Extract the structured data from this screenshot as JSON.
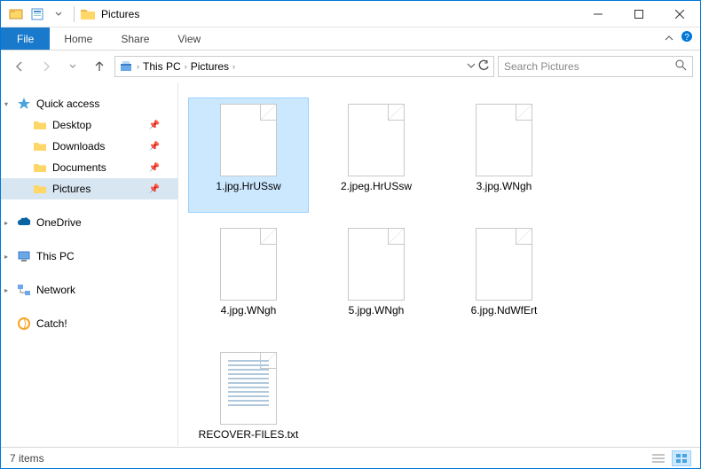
{
  "title": "Pictures",
  "tabs": {
    "file": "File",
    "home": "Home",
    "share": "Share",
    "view": "View"
  },
  "breadcrumbs": [
    "This PC",
    "Pictures"
  ],
  "search": {
    "placeholder": "Search Pictures"
  },
  "sidebar": {
    "quick_access": "Quick access",
    "items": [
      {
        "label": "Desktop",
        "pinned": true
      },
      {
        "label": "Downloads",
        "pinned": true
      },
      {
        "label": "Documents",
        "pinned": true
      },
      {
        "label": "Pictures",
        "pinned": true,
        "selected": true
      }
    ],
    "onedrive": "OneDrive",
    "thispc": "This PC",
    "network": "Network",
    "catch": "Catch!"
  },
  "files": [
    {
      "name": "1.jpg.HrUSsw",
      "type": "blank",
      "selected": true
    },
    {
      "name": "2.jpeg.HrUSsw",
      "type": "blank"
    },
    {
      "name": "3.jpg.WNgh",
      "type": "blank"
    },
    {
      "name": "4.jpg.WNgh",
      "type": "blank"
    },
    {
      "name": "5.jpg.WNgh",
      "type": "blank"
    },
    {
      "name": "6.jpg.NdWfErt",
      "type": "blank"
    },
    {
      "name": "RECOVER-FILES.txt",
      "type": "txt"
    }
  ],
  "status": {
    "count": "7 items"
  }
}
